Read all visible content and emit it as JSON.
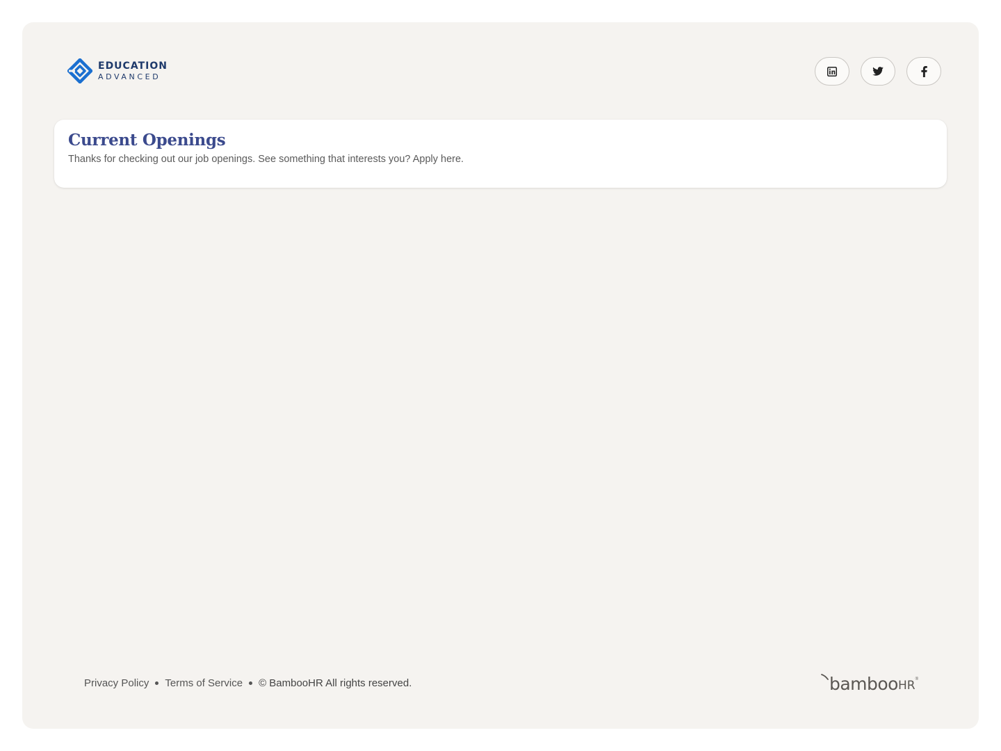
{
  "brand": {
    "name_line1": "EDUCATION",
    "name_line2": "ADVANCED",
    "accent_color": "#1a6fd0",
    "text_color": "#1f3a6b"
  },
  "social": [
    {
      "name": "LinkedIn",
      "icon": "linkedin-icon"
    },
    {
      "name": "Twitter",
      "icon": "twitter-icon"
    },
    {
      "name": "Facebook",
      "icon": "facebook-icon"
    }
  ],
  "openings": {
    "title": "Current Openings",
    "subtitle": "Thanks for checking out our job openings. See something that interests you? Apply here."
  },
  "footer": {
    "privacy_label": "Privacy Policy",
    "terms_label": "Terms of Service",
    "copyright": "© BambooHR All rights reserved.",
    "powered_by": {
      "main": "bamboo",
      "suffix": "HR"
    }
  },
  "colors": {
    "background": "#f5f3f0",
    "title": "#3b4a8d"
  }
}
